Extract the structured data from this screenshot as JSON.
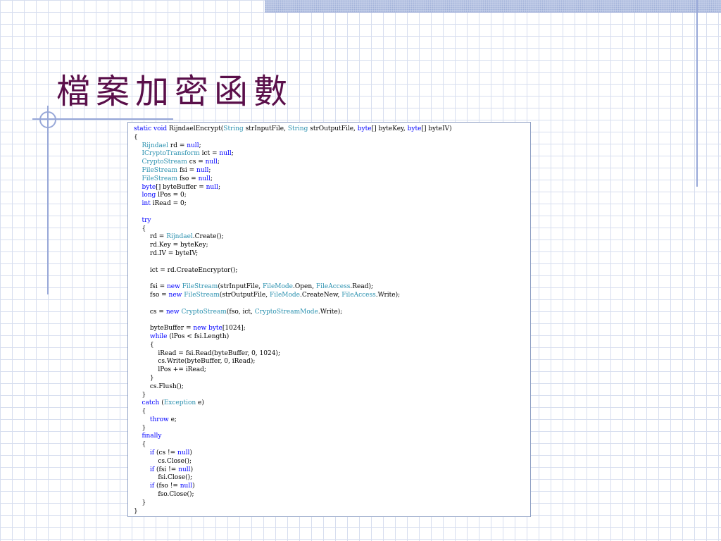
{
  "slide": {
    "title": "檔案加密函數"
  },
  "colors": {
    "title": "#5a0f4a",
    "keyword": "#0000ff",
    "type": "#2b91af",
    "plain": "#000000",
    "grid": "#d7deef",
    "accent_lines": "#98a8d8"
  },
  "code_lines": [
    [
      [
        "kw",
        "static"
      ],
      [
        "p",
        " "
      ],
      [
        "kw",
        "void"
      ],
      [
        "p",
        " RijndaelEncrypt("
      ],
      [
        "ty",
        "String"
      ],
      [
        "p",
        " strInputFile, "
      ],
      [
        "ty",
        "String"
      ],
      [
        "p",
        " strOutputFile, "
      ],
      [
        "kw",
        "byte"
      ],
      [
        "p",
        "[] byteKey, "
      ],
      [
        "kw",
        "byte"
      ],
      [
        "p",
        "[] byteIV)"
      ]
    ],
    [
      [
        "p",
        "{"
      ]
    ],
    [
      [
        "p",
        "    "
      ],
      [
        "ty",
        "Rijndael"
      ],
      [
        "p",
        " rd = "
      ],
      [
        "kw",
        "null"
      ],
      [
        "p",
        ";"
      ]
    ],
    [
      [
        "p",
        "    "
      ],
      [
        "ty",
        "ICryptoTransform"
      ],
      [
        "p",
        " ict = "
      ],
      [
        "kw",
        "null"
      ],
      [
        "p",
        ";"
      ]
    ],
    [
      [
        "p",
        "    "
      ],
      [
        "ty",
        "CryptoStream"
      ],
      [
        "p",
        " cs = "
      ],
      [
        "kw",
        "null"
      ],
      [
        "p",
        ";"
      ]
    ],
    [
      [
        "p",
        "    "
      ],
      [
        "ty",
        "FileStream"
      ],
      [
        "p",
        " fsi = "
      ],
      [
        "kw",
        "null"
      ],
      [
        "p",
        ";"
      ]
    ],
    [
      [
        "p",
        "    "
      ],
      [
        "ty",
        "FileStream"
      ],
      [
        "p",
        " fso = "
      ],
      [
        "kw",
        "null"
      ],
      [
        "p",
        ";"
      ]
    ],
    [
      [
        "p",
        "    "
      ],
      [
        "kw",
        "byte"
      ],
      [
        "p",
        "[] byteBuffer = "
      ],
      [
        "kw",
        "null"
      ],
      [
        "p",
        ";"
      ]
    ],
    [
      [
        "p",
        "    "
      ],
      [
        "kw",
        "long"
      ],
      [
        "p",
        " lPos = 0;"
      ]
    ],
    [
      [
        "p",
        "    "
      ],
      [
        "kw",
        "int"
      ],
      [
        "p",
        " iRead = 0;"
      ]
    ],
    [],
    [
      [
        "p",
        "    "
      ],
      [
        "kw",
        "try"
      ]
    ],
    [
      [
        "p",
        "    {"
      ]
    ],
    [
      [
        "p",
        "        rd = "
      ],
      [
        "ty",
        "Rijndael"
      ],
      [
        "p",
        ".Create();"
      ]
    ],
    [
      [
        "p",
        "        rd.Key = byteKey;"
      ]
    ],
    [
      [
        "p",
        "        rd.IV = byteIV;"
      ]
    ],
    [],
    [
      [
        "p",
        "        ict = rd.CreateEncryptor();"
      ]
    ],
    [],
    [
      [
        "p",
        "        fsi = "
      ],
      [
        "kw",
        "new"
      ],
      [
        "p",
        " "
      ],
      [
        "ty",
        "FileStream"
      ],
      [
        "p",
        "(strInputFile, "
      ],
      [
        "ty",
        "FileMode"
      ],
      [
        "p",
        ".Open, "
      ],
      [
        "ty",
        "FileAccess"
      ],
      [
        "p",
        ".Read);"
      ]
    ],
    [
      [
        "p",
        "        fso = "
      ],
      [
        "kw",
        "new"
      ],
      [
        "p",
        " "
      ],
      [
        "ty",
        "FileStream"
      ],
      [
        "p",
        "(strOutputFile, "
      ],
      [
        "ty",
        "FileMode"
      ],
      [
        "p",
        ".CreateNew, "
      ],
      [
        "ty",
        "FileAccess"
      ],
      [
        "p",
        ".Write);"
      ]
    ],
    [],
    [
      [
        "p",
        "        cs = "
      ],
      [
        "kw",
        "new"
      ],
      [
        "p",
        " "
      ],
      [
        "ty",
        "CryptoStream"
      ],
      [
        "p",
        "(fso, ict, "
      ],
      [
        "ty",
        "CryptoStreamMode"
      ],
      [
        "p",
        ".Write);"
      ]
    ],
    [],
    [
      [
        "p",
        "        byteBuffer = "
      ],
      [
        "kw",
        "new"
      ],
      [
        "p",
        " "
      ],
      [
        "kw",
        "byte"
      ],
      [
        "p",
        "[1024];"
      ]
    ],
    [
      [
        "p",
        "        "
      ],
      [
        "kw",
        "while"
      ],
      [
        "p",
        " (lPos < fsi.Length)"
      ]
    ],
    [
      [
        "p",
        "        {"
      ]
    ],
    [
      [
        "p",
        "            iRead = fsi.Read(byteBuffer, 0, 1024);"
      ]
    ],
    [
      [
        "p",
        "            cs.Write(byteBuffer, 0, iRead);"
      ]
    ],
    [
      [
        "p",
        "            lPos += iRead;"
      ]
    ],
    [
      [
        "p",
        "        }"
      ]
    ],
    [
      [
        "p",
        "        cs.Flush();"
      ]
    ],
    [
      [
        "p",
        "    }"
      ]
    ],
    [
      [
        "p",
        "    "
      ],
      [
        "kw",
        "catch"
      ],
      [
        "p",
        " ("
      ],
      [
        "ty",
        "Exception"
      ],
      [
        "p",
        " e)"
      ]
    ],
    [
      [
        "p",
        "    {"
      ]
    ],
    [
      [
        "p",
        "        "
      ],
      [
        "kw",
        "throw"
      ],
      [
        "p",
        " e;"
      ]
    ],
    [
      [
        "p",
        "    }"
      ]
    ],
    [
      [
        "p",
        "    "
      ],
      [
        "kw",
        "finally"
      ]
    ],
    [
      [
        "p",
        "    {"
      ]
    ],
    [
      [
        "p",
        "        "
      ],
      [
        "kw",
        "if"
      ],
      [
        "p",
        " (cs != "
      ],
      [
        "kw",
        "null"
      ],
      [
        "p",
        ")"
      ]
    ],
    [
      [
        "p",
        "            cs.Close();"
      ]
    ],
    [
      [
        "p",
        "        "
      ],
      [
        "kw",
        "if"
      ],
      [
        "p",
        " (fsi != "
      ],
      [
        "kw",
        "null"
      ],
      [
        "p",
        ")"
      ]
    ],
    [
      [
        "p",
        "            fsi.Close();"
      ]
    ],
    [
      [
        "p",
        "        "
      ],
      [
        "kw",
        "if"
      ],
      [
        "p",
        " (fso != "
      ],
      [
        "kw",
        "null"
      ],
      [
        "p",
        ")"
      ]
    ],
    [
      [
        "p",
        "            fso.Close();"
      ]
    ],
    [
      [
        "p",
        "    }"
      ]
    ],
    [
      [
        "p",
        "}"
      ]
    ]
  ]
}
